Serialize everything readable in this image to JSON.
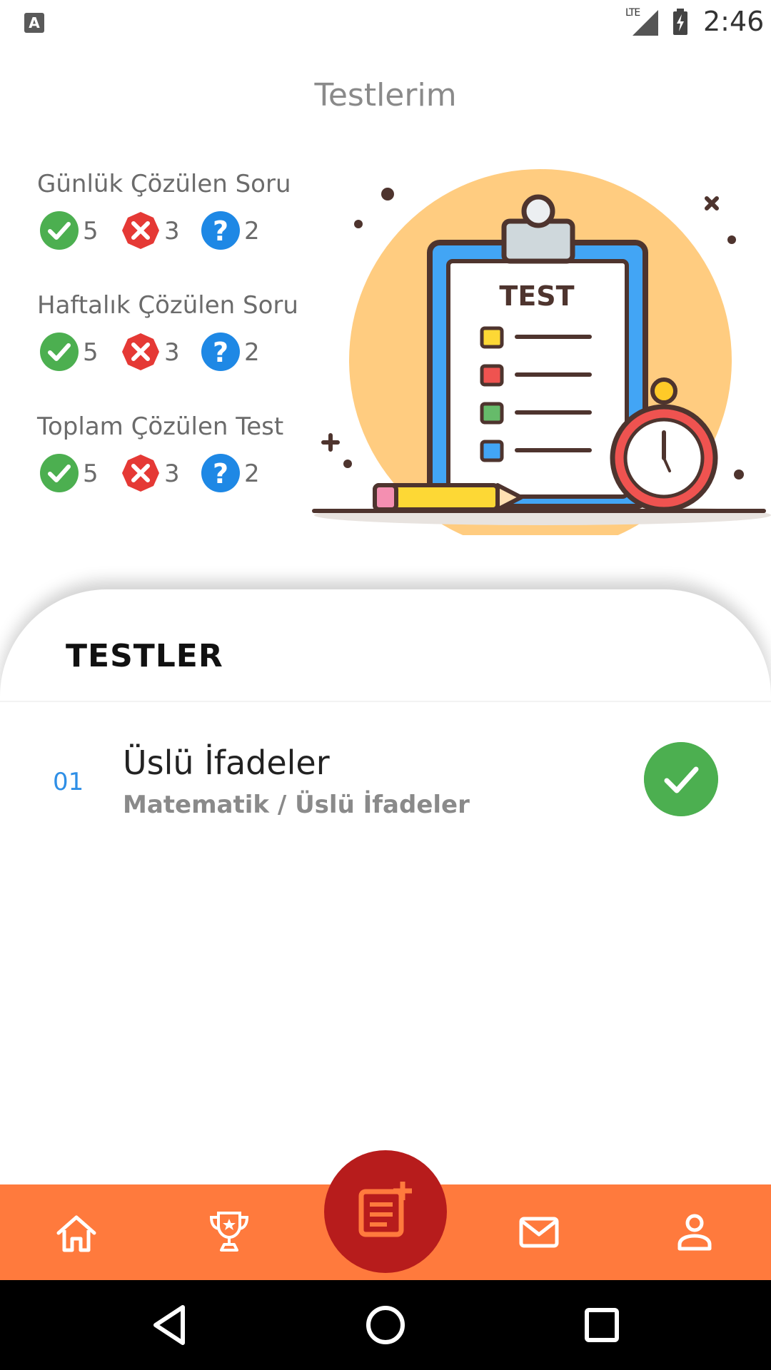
{
  "status_bar": {
    "app_badge": "A",
    "network": "LTE",
    "time": "2:46"
  },
  "header": {
    "title": "Testlerim"
  },
  "stats": [
    {
      "label": "Günlük Çözülen Soru",
      "correct": "5",
      "wrong": "3",
      "empty": "2"
    },
    {
      "label": "Haftalık Çözülen Soru",
      "correct": "5",
      "wrong": "3",
      "empty": "2"
    },
    {
      "label": "Toplam Çözülen Test",
      "correct": "5",
      "wrong": "3",
      "empty": "2"
    }
  ],
  "illustration": {
    "clipboard_text": "TEST"
  },
  "sheet": {
    "title": "TESTLER",
    "tests": [
      {
        "index": "01",
        "name": "Üslü İfadeler",
        "subtitle": "Matematik / Üslü İfadeler",
        "status": "completed"
      }
    ]
  },
  "nav": {
    "items": [
      "home-icon",
      "trophy-icon",
      "add-test-icon",
      "mail-icon",
      "profile-icon"
    ],
    "color": "#ff7a3d",
    "fab_color": "#b71c1c"
  },
  "system_nav": [
    "back-icon",
    "home-circle-icon",
    "recents-icon"
  ],
  "colors": {
    "correct": "#4caf50",
    "wrong": "#e53935",
    "empty": "#1e88e5",
    "accent": "#ff7a3d"
  }
}
